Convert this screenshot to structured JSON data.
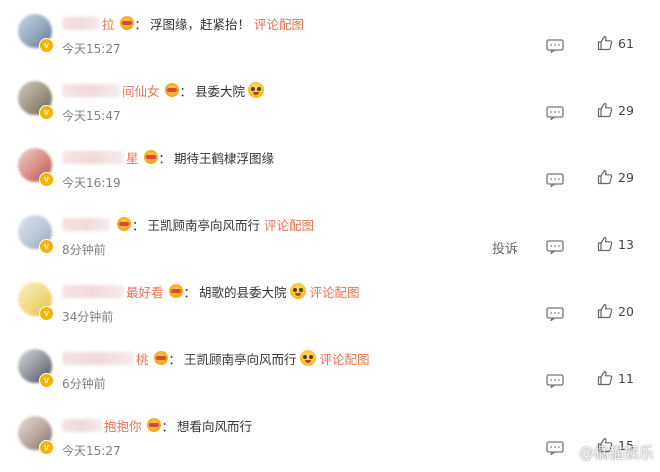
{
  "colors": {
    "accent": "#eb7350",
    "badge": "#f5b400",
    "text": "#333333",
    "muted": "#808080"
  },
  "icons": {
    "reply": "comment-reply-icon",
    "like": "thumbs-up-icon",
    "verified": "v-badge-icon"
  },
  "comments": [
    {
      "name_visible": "拉",
      "badge": true,
      "text": "浮图缘，赶紧抬！",
      "emoji": false,
      "pic_link": "评论配图",
      "time": "今天15:27",
      "report": "",
      "likes": "61"
    },
    {
      "name_visible": "间仙女",
      "badge": true,
      "text": "县委大院",
      "emoji": true,
      "pic_link": "",
      "time": "今天15:47",
      "report": "",
      "likes": "29"
    },
    {
      "name_visible": "星",
      "badge": true,
      "text": "期待王鹤棣浮图缘",
      "emoji": false,
      "pic_link": "",
      "time": "今天16:19",
      "report": "",
      "likes": "29"
    },
    {
      "name_visible": "",
      "badge": true,
      "text": "王凯顾南亭向风而行",
      "emoji": false,
      "pic_link": "评论配图",
      "time": "8分钟前",
      "report": "投诉",
      "likes": "13"
    },
    {
      "name_visible": "最好看",
      "badge": true,
      "text": "胡歌的县委大院",
      "emoji": true,
      "pic_link": "评论配图",
      "time": "34分钟前",
      "report": "",
      "likes": "20"
    },
    {
      "name_visible": "桃",
      "badge": true,
      "text": "王凯顾南亭向风而行",
      "emoji": true,
      "pic_link": "评论配图",
      "time": "6分钟前",
      "report": "",
      "likes": "11"
    },
    {
      "name_visible": "抱抱你",
      "badge": true,
      "text": "想看向风而行",
      "emoji": false,
      "pic_link": "",
      "time": "今天15:27",
      "report": "",
      "likes": "15"
    }
  ],
  "watermark": "@橘猫娱乐"
}
